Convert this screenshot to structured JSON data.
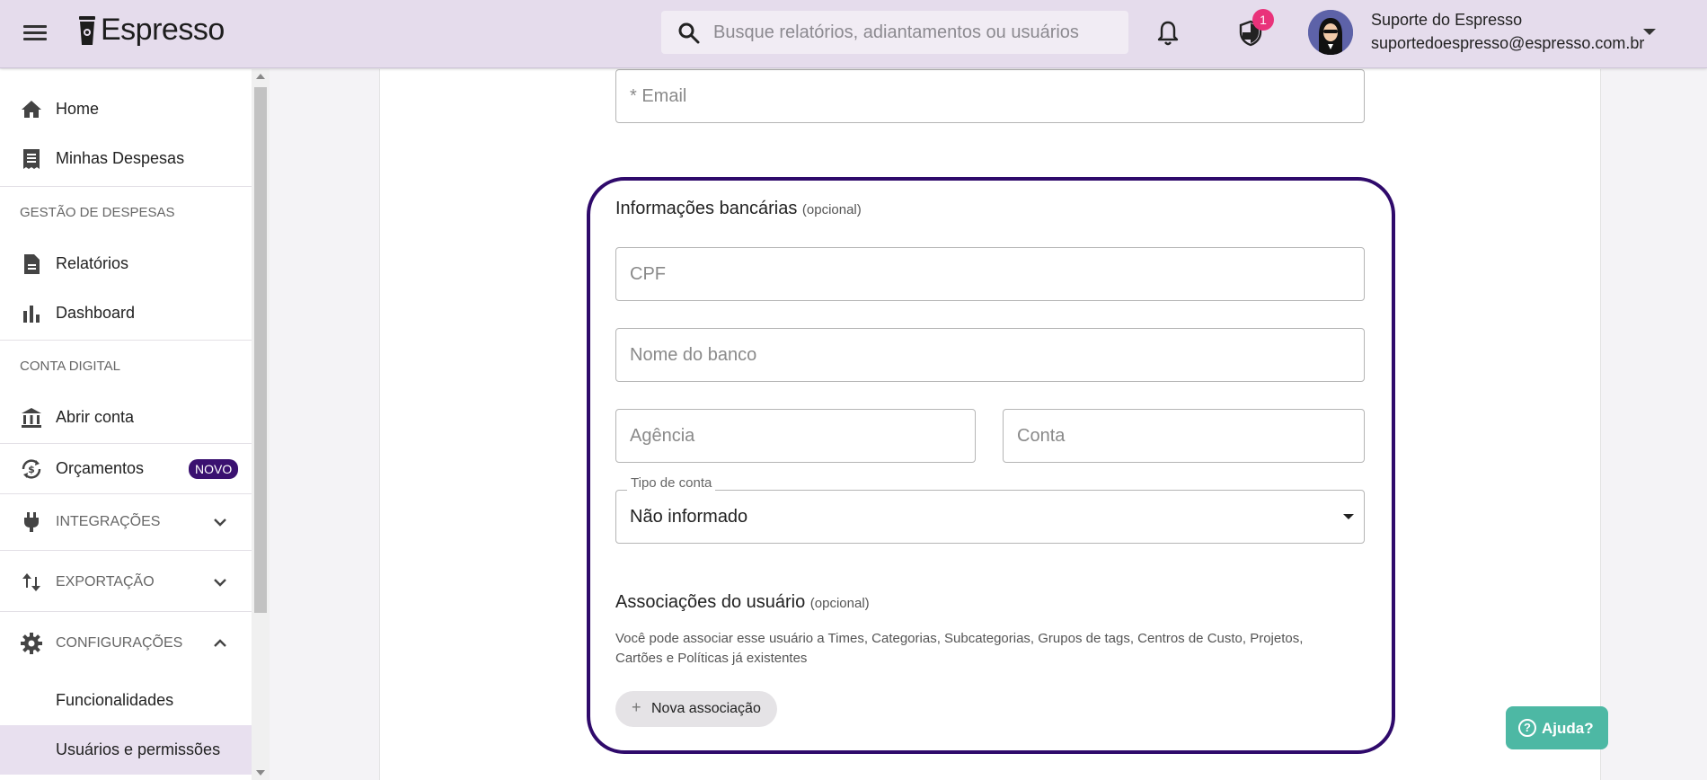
{
  "header": {
    "app_name": "Espresso",
    "search_placeholder": "Busque relatórios, adiantamentos ou usuários",
    "notification_badge": "1",
    "user_name": "Suporte do Espresso",
    "user_email": "suportedoespresso@espresso.com.br"
  },
  "sidebar": {
    "home": "Home",
    "my_expenses": "Minhas Despesas",
    "section_expenses": "GESTÃO DE DESPESAS",
    "reports": "Relatórios",
    "dashboard": "Dashboard",
    "section_digital": "CONTA DIGITAL",
    "open_account": "Abrir conta",
    "budgets": "Orçamentos",
    "budgets_badge": "NOVO",
    "integrations": "INTEGRAÇÕES",
    "export": "EXPORTAÇÃO",
    "settings": "CONFIGURAÇÕES",
    "features": "Funcionalidades",
    "users_permissions": "Usuários e permissões"
  },
  "form": {
    "email_placeholder": "* Email",
    "bank_title": "Informações bancárias",
    "bank_optional": "(opcional)",
    "cpf_placeholder": "CPF",
    "bank_name_placeholder": "Nome do banco",
    "agency_placeholder": "Agência",
    "account_placeholder": "Conta",
    "account_type_label": "Tipo de conta",
    "account_type_value": "Não informado",
    "assoc_title": "Associações do usuário",
    "assoc_optional": "(opcional)",
    "assoc_description": "Você pode associar esse usuário a Times, Categorias, Subcategorias, Grupos de tags, Centros de Custo, Projetos, Cartões e Políticas já existentes",
    "new_association": "Nova associação"
  },
  "help": {
    "label": "Ajuda?"
  },
  "colors": {
    "header_bg": "#e5dcec",
    "brand_purple": "#2f0a6b",
    "badge_pink": "#e9327a",
    "help_teal": "#4db8a4"
  }
}
